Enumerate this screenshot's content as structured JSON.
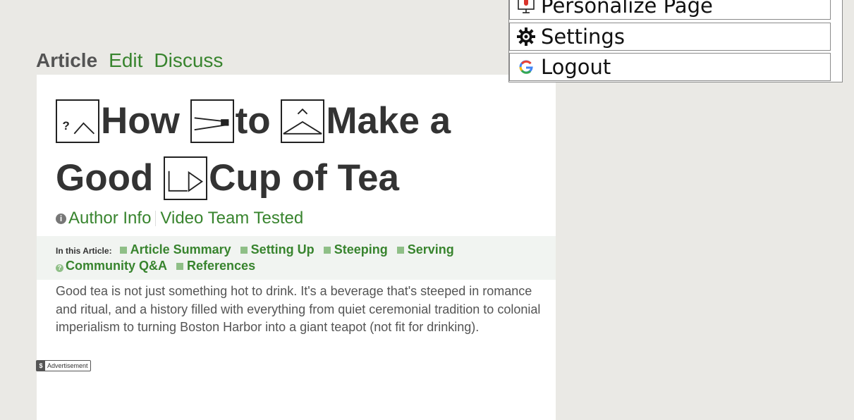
{
  "tabs": [
    "Article",
    "Edit",
    "Discuss"
  ],
  "article": {
    "title_words": [
      "How",
      "to",
      "Make a",
      "Good",
      "Cup of Tea"
    ],
    "meta": {
      "author_info": "Author Info",
      "tested": "Video Team Tested"
    },
    "toc": {
      "label": "In this Article:",
      "items": [
        "Article Summary",
        "Setting Up",
        "Steeping",
        "Serving",
        "Community Q&A",
        "References"
      ]
    },
    "intro": "Good tea is not just something hot to drink. It's a beverage that's steeped in romance and ritual, and a history filled with everything from quiet ceremonial tradition to colonial imperialism to turning Boston Harbor into a giant teapot (not fit for drinking).",
    "ad_label": "Advertisement",
    "ad_symbol": "$"
  },
  "menu": {
    "items": [
      {
        "label": "Personalize Page",
        "icon": "microphone-monitor-icon"
      },
      {
        "label": "Settings",
        "icon": "gear-icon"
      },
      {
        "label": "Logout",
        "icon": "google-logo-icon"
      }
    ]
  },
  "colors": {
    "accent": "#38842e",
    "background": "#eae9e5"
  }
}
